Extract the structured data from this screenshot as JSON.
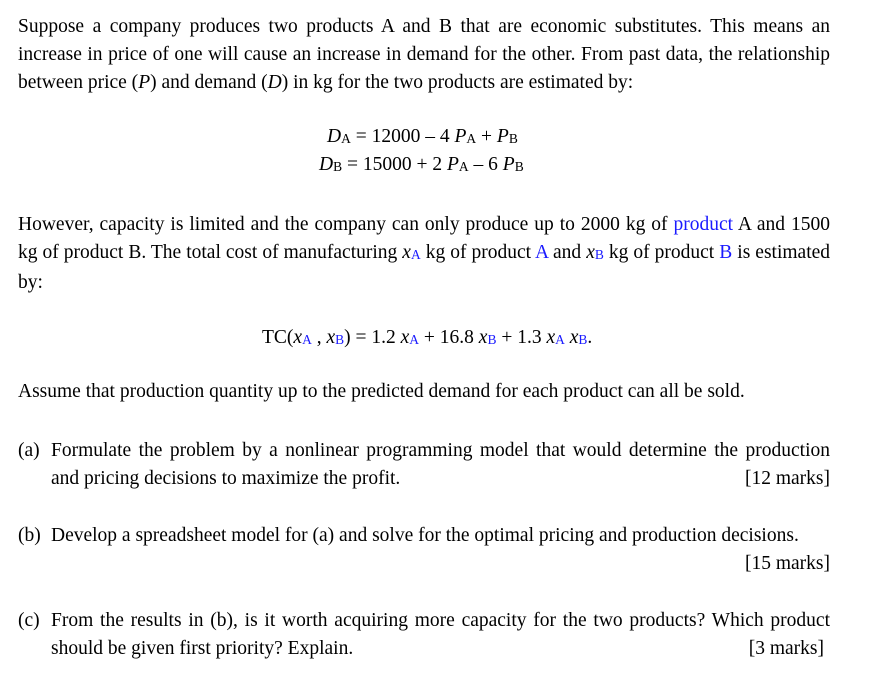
{
  "intro": {
    "line1": "Suppose a company produces two products A and B that are economic substitutes. This means an",
    "line2": "increase in price of one will cause an increase in demand for the other. From past data, the relationship",
    "line3_pre": "between price (",
    "line3_P": "P",
    "line3_mid": ") and demand (",
    "line3_D": "D",
    "line3_post": ") in kg for the two products are estimated by:"
  },
  "demand_equations": [
    {
      "lhs_var": "D",
      "lhs_sub": "A",
      "text1": " = 12000 – 4 ",
      "v1": "P",
      "s1": "A",
      "text2": " + ",
      "v2": "P",
      "s2": "B"
    },
    {
      "lhs_var": "D",
      "lhs_sub": "B",
      "text1": " = 15000 + 2 ",
      "v1": "P",
      "s1": "A",
      "text2": " – 6 ",
      "v2": "P",
      "s2": "B"
    }
  ],
  "capacity": {
    "line1_pre": "However, capacity is limited and the company can only produce up to 2000 kg of ",
    "line1_link": "product",
    "line1_post": " A and 1500",
    "line2_a": "kg of product B. The total cost of manufacturing ",
    "x": "x",
    "sub_A": "A",
    "sub_B": "B",
    "line2_b": " kg of product ",
    "prodA": "A",
    "line2_c": " and ",
    "line2_d": " kg of product ",
    "prodB": "B",
    "line2_e": " is estimated",
    "line3": "by:"
  },
  "cost_equation": {
    "tc": "TC(",
    "x": "x",
    "sA": "A",
    "sB": "B",
    "comma": " , ",
    "close": ") = 1.2 ",
    "plus1": " + 16.8 ",
    "plus2": " + 1.3 ",
    "space": " ",
    "end": "."
  },
  "assume": "Assume that production quantity up to the predicted demand for each product can all be sold.",
  "questions": [
    {
      "label": "(a)",
      "line1": "Formulate the problem by a nonlinear programming model that would determine the production",
      "line2": "and pricing decisions to maximize the profit.",
      "marks": "[12 marks]"
    },
    {
      "label": "(b)",
      "line1": "Develop a spreadsheet model for (a) and solve for the optimal pricing and production decisions.",
      "marks": "[15 marks]"
    },
    {
      "label": "(c)",
      "line1": "From the results in (b), is it worth acquiring more capacity for the two products? Which product",
      "line2": "should be given first priority? Explain.",
      "marks": "[3 marks]"
    }
  ],
  "colors": {
    "text": "#000000",
    "highlight": "#1a1aff"
  }
}
